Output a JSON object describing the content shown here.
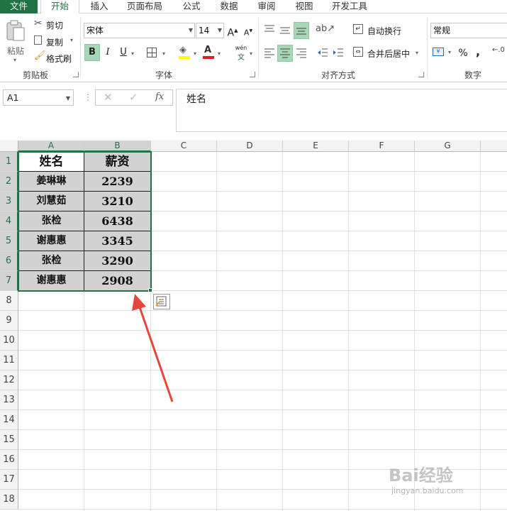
{
  "ribbon_tabs": {
    "file": "文件",
    "home": "开始",
    "insert": "插入",
    "page_layout": "页面布局",
    "formulas": "公式",
    "data": "数据",
    "review": "审阅",
    "view": "视图",
    "developer": "开发工具"
  },
  "clipboard": {
    "paste": "粘贴",
    "cut": "剪切",
    "copy": "复制",
    "format_painter": "格式刷",
    "group_label": "剪贴板"
  },
  "font": {
    "font_name": "宋体",
    "font_size": "14",
    "grow": "A",
    "shrink": "A",
    "bold": "B",
    "italic": "I",
    "underline": "U",
    "phonetic": "wén",
    "phonetic_char": "文",
    "group_label": "字体"
  },
  "alignment": {
    "wrap_text": "自动换行",
    "merge_center": "合并后居中",
    "group_label": "对齐方式"
  },
  "number": {
    "format": "常规",
    "percent": "%",
    "comma": ",",
    "group_label": "数字"
  },
  "formula_bar": {
    "name_box": "A1",
    "formula_value": "姓名",
    "fx": "fx"
  },
  "columns": [
    "A",
    "B",
    "C",
    "D",
    "E",
    "F",
    "G"
  ],
  "rows": [
    "1",
    "2",
    "3",
    "4",
    "5",
    "6",
    "7",
    "8",
    "9",
    "10",
    "11",
    "12",
    "13",
    "14",
    "15",
    "16",
    "17",
    "18"
  ],
  "table": {
    "headers": [
      "姓名",
      "薪资"
    ],
    "rows": [
      [
        "姜琳琳",
        "2239"
      ],
      [
        "刘慧茹",
        "3210"
      ],
      [
        "张检",
        "6438"
      ],
      [
        "谢惠惠",
        "3345"
      ],
      [
        "张检",
        "3290"
      ],
      [
        "谢惠惠",
        "2908"
      ]
    ]
  },
  "colors": {
    "accent": "#217346",
    "selection_fill": "#d2d2d2",
    "arrow": "#e8453c"
  },
  "watermark": {
    "brand": "Bai经验",
    "url": "jingyan.baidu.com"
  }
}
